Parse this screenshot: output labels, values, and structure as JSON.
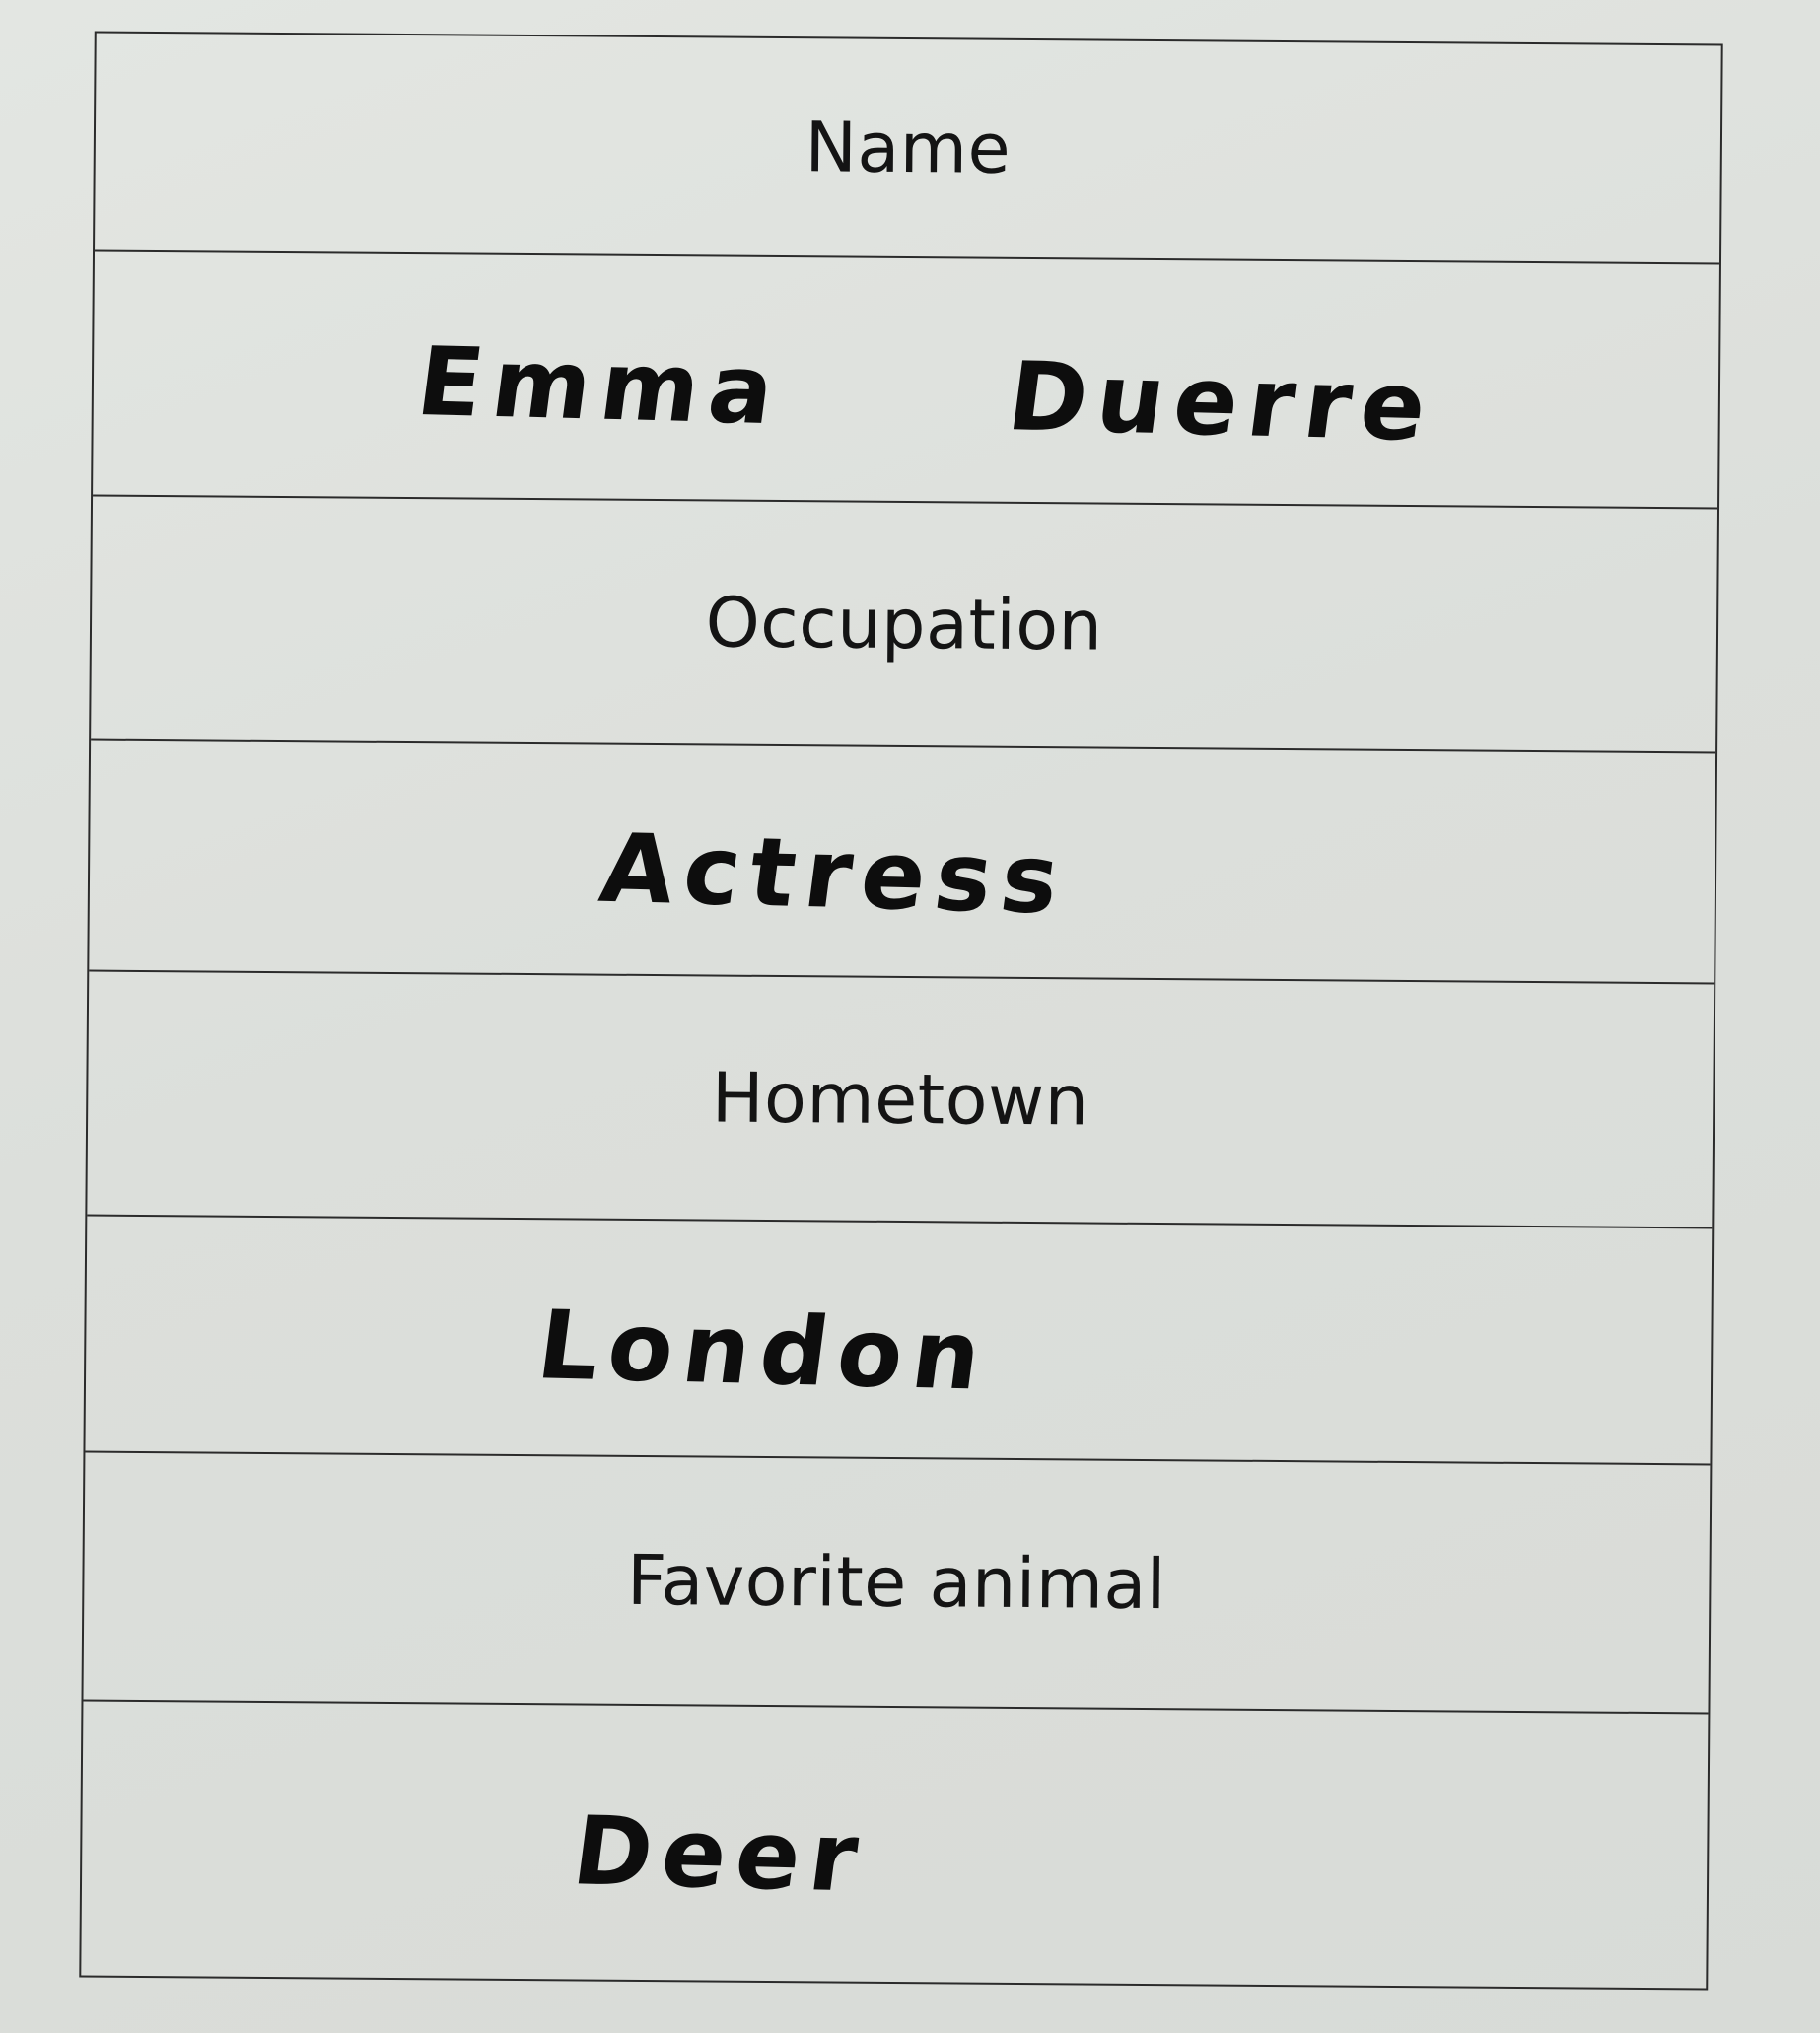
{
  "form": {
    "rows": [
      {
        "type": "label",
        "text": "Name"
      },
      {
        "type": "answer",
        "first": "Emma",
        "last": "Duerre"
      },
      {
        "type": "label",
        "text": "Occupation"
      },
      {
        "type": "answer",
        "text": "Actress"
      },
      {
        "type": "label",
        "text": "Hometown"
      },
      {
        "type": "answer",
        "text": "London"
      },
      {
        "type": "label",
        "text": "Favorite animal"
      },
      {
        "type": "answer",
        "text": "Deer"
      }
    ]
  }
}
